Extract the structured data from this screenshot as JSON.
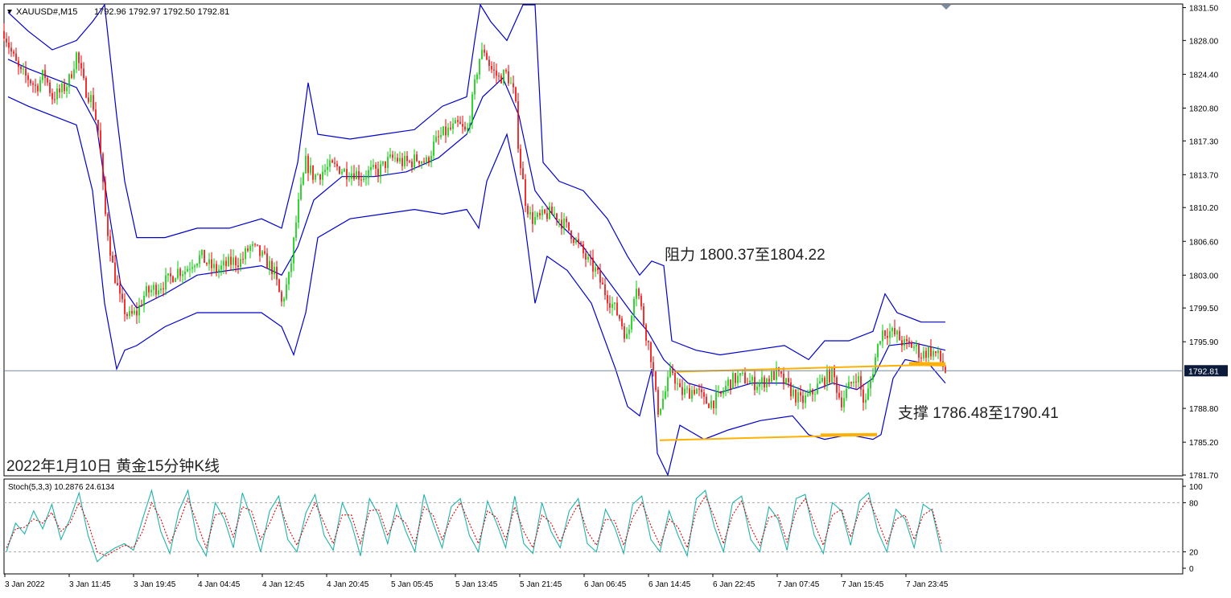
{
  "header": {
    "symbol": "XAUUSD#,M15",
    "ohlc": "1792.96 1792.97 1792.50 1792.81"
  },
  "annotations": {
    "resistance": "阻力 1800.37至1804.22",
    "support": "支撑 1786.48至1790.41",
    "caption": "2022年1月10日 黄金15分钟K线"
  },
  "colors": {
    "background": "#ffffff",
    "bull_candle": "#00cc00",
    "bear_candle": "#ee0000",
    "bollinger": "#0000cc",
    "level_line": "#ffb000",
    "stoch_main": "#20b2aa",
    "stoch_signal": "#dd0000",
    "grid_dash": "#aaaaaa",
    "price_marker_bg": "#0b1a3a"
  },
  "chart_data": [
    {
      "type": "candlestick",
      "y_ticks": [
        "1831.50",
        "1828.00",
        "1824.40",
        "1820.80",
        "1817.30",
        "1813.70",
        "1810.20",
        "1806.60",
        "1803.00",
        "1799.50",
        "1795.90",
        "1788.80",
        "1785.20",
        "1781.70"
      ],
      "ylim": [
        1781.7,
        1831.8
      ],
      "current_price": "1792.81",
      "x_ticks": [
        "3 Jan 2022",
        "3 Jan 11:45",
        "3 Jan 19:45",
        "4 Jan 04:45",
        "4 Jan 12:45",
        "4 Jan 20:45",
        "5 Jan 05:45",
        "5 Jan 13:45",
        "5 Jan 21:45",
        "6 Jan 06:45",
        "6 Jan 14:45",
        "6 Jan 22:45",
        "7 Jan 07:45",
        "7 Jan 15:45",
        "7 Jan 23:45"
      ],
      "close_path": [
        [
          0,
          1829.0
        ],
        [
          10,
          1826.5
        ],
        [
          20,
          1824.5
        ],
        [
          30,
          1824.0
        ],
        [
          40,
          1823.0
        ],
        [
          50,
          1824.5
        ],
        [
          60,
          1822.0
        ],
        [
          70,
          1822.5
        ],
        [
          80,
          1823.5
        ],
        [
          90,
          1826.5
        ],
        [
          100,
          1823.0
        ],
        [
          110,
          1821.5
        ],
        [
          118,
          1818.0
        ],
        [
          125,
          1810.0
        ],
        [
          135,
          1804.0
        ],
        [
          145,
          1800.0
        ],
        [
          155,
          1798.5
        ],
        [
          165,
          1799.0
        ],
        [
          175,
          1801.0
        ],
        [
          185,
          1801.5
        ],
        [
          195,
          1802.0
        ],
        [
          205,
          1802.5
        ],
        [
          215,
          1803.5
        ],
        [
          225,
          1803.5
        ],
        [
          235,
          1804.5
        ],
        [
          245,
          1805.0
        ],
        [
          255,
          1804.0
        ],
        [
          265,
          1803.5
        ],
        [
          275,
          1804.0
        ],
        [
          285,
          1804.5
        ],
        [
          295,
          1804.5
        ],
        [
          305,
          1806.0
        ],
        [
          315,
          1805.5
        ],
        [
          325,
          1804.5
        ],
        [
          335,
          1803.5
        ],
        [
          345,
          1800.0
        ],
        [
          355,
          1803.0
        ],
        [
          365,
          1810.0
        ],
        [
          375,
          1815.0
        ],
        [
          385,
          1813.5
        ],
        [
          395,
          1814.0
        ],
        [
          405,
          1814.5
        ],
        [
          415,
          1814.5
        ],
        [
          425,
          1814.0
        ],
        [
          435,
          1814.0
        ],
        [
          445,
          1813.5
        ],
        [
          455,
          1814.0
        ],
        [
          465,
          1814.0
        ],
        [
          475,
          1815.0
        ],
        [
          485,
          1815.5
        ],
        [
          495,
          1815.0
        ],
        [
          505,
          1815.0
        ],
        [
          515,
          1815.5
        ],
        [
          525,
          1815.0
        ],
        [
          535,
          1817.0
        ],
        [
          545,
          1818.0
        ],
        [
          555,
          1818.5
        ],
        [
          565,
          1819.0
        ],
        [
          575,
          1818.0
        ],
        [
          583,
          1822.0
        ],
        [
          590,
          1826.0
        ],
        [
          597,
          1827.0
        ],
        [
          605,
          1825.0
        ],
        [
          615,
          1824.0
        ],
        [
          625,
          1824.5
        ],
        [
          635,
          1822.0
        ],
        [
          640,
          1816.0
        ],
        [
          648,
          1811.0
        ],
        [
          655,
          1809.0
        ],
        [
          665,
          1809.0
        ],
        [
          675,
          1809.5
        ],
        [
          685,
          1809.5
        ],
        [
          695,
          1808.5
        ],
        [
          705,
          1807.5
        ],
        [
          715,
          1806.0
        ],
        [
          725,
          1804.5
        ],
        [
          735,
          1803.5
        ],
        [
          745,
          1801.5
        ],
        [
          755,
          1800.0
        ],
        [
          765,
          1798.5
        ],
        [
          775,
          1796.0
        ],
        [
          785,
          1802.5
        ],
        [
          795,
          1798.0
        ],
        [
          805,
          1794.0
        ],
        [
          812,
          1788.5
        ],
        [
          820,
          1790.0
        ],
        [
          830,
          1793.0
        ],
        [
          840,
          1790.5
        ],
        [
          850,
          1790.5
        ],
        [
          860,
          1791.0
        ],
        [
          870,
          1789.5
        ],
        [
          880,
          1789.5
        ],
        [
          890,
          1790.0
        ],
        [
          900,
          1791.5
        ],
        [
          910,
          1792.0
        ],
        [
          920,
          1792.0
        ],
        [
          930,
          1791.5
        ],
        [
          940,
          1791.5
        ],
        [
          950,
          1792.0
        ],
        [
          960,
          1792.5
        ],
        [
          970,
          1791.5
        ],
        [
          980,
          1790.5
        ],
        [
          990,
          1789.5
        ],
        [
          1000,
          1790.0
        ],
        [
          1010,
          1791.0
        ],
        [
          1020,
          1792.0
        ],
        [
          1030,
          1792.5
        ],
        [
          1040,
          1789.5
        ],
        [
          1050,
          1791.0
        ],
        [
          1060,
          1792.5
        ],
        [
          1070,
          1789.0
        ],
        [
          1080,
          1793.0
        ],
        [
          1090,
          1797.0
        ],
        [
          1100,
          1797.0
        ],
        [
          1110,
          1796.5
        ],
        [
          1120,
          1795.5
        ],
        [
          1130,
          1795.5
        ],
        [
          1140,
          1794.5
        ],
        [
          1150,
          1795.0
        ],
        [
          1160,
          1794.5
        ],
        [
          1170,
          1792.8
        ]
      ],
      "bb_mid": [
        [
          5,
          1826
        ],
        [
          30,
          1825
        ],
        [
          60,
          1824
        ],
        [
          90,
          1823
        ],
        [
          115,
          1819
        ],
        [
          130,
          1810
        ],
        [
          145,
          1802
        ],
        [
          165,
          1799.5
        ],
        [
          200,
          1801
        ],
        [
          240,
          1803
        ],
        [
          280,
          1803.5
        ],
        [
          320,
          1804
        ],
        [
          345,
          1803
        ],
        [
          365,
          1806
        ],
        [
          385,
          1811
        ],
        [
          420,
          1813.5
        ],
        [
          460,
          1813.5
        ],
        [
          500,
          1814
        ],
        [
          540,
          1815.5
        ],
        [
          575,
          1818
        ],
        [
          595,
          1822
        ],
        [
          620,
          1824
        ],
        [
          640,
          1820
        ],
        [
          660,
          1812
        ],
        [
          690,
          1808.5
        ],
        [
          720,
          1806
        ],
        [
          750,
          1802.5
        ],
        [
          780,
          1799
        ],
        [
          800,
          1797
        ],
        [
          820,
          1794
        ],
        [
          850,
          1791.5
        ],
        [
          890,
          1790.5
        ],
        [
          930,
          1791.5
        ],
        [
          970,
          1791.5
        ],
        [
          1000,
          1790.5
        ],
        [
          1030,
          1791.5
        ],
        [
          1060,
          1790.8
        ],
        [
          1080,
          1792
        ],
        [
          1100,
          1795.5
        ],
        [
          1130,
          1795.8
        ],
        [
          1170,
          1795
        ]
      ],
      "bb_upper": [
        [
          5,
          1831
        ],
        [
          30,
          1829
        ],
        [
          60,
          1827
        ],
        [
          90,
          1828
        ],
        [
          110,
          1830
        ],
        [
          125,
          1831.8
        ],
        [
          140,
          1820
        ],
        [
          150,
          1813
        ],
        [
          165,
          1807
        ],
        [
          200,
          1807
        ],
        [
          240,
          1808
        ],
        [
          280,
          1808
        ],
        [
          320,
          1809
        ],
        [
          345,
          1808
        ],
        [
          365,
          1815
        ],
        [
          378,
          1823.5
        ],
        [
          390,
          1818
        ],
        [
          430,
          1817.5
        ],
        [
          470,
          1818
        ],
        [
          510,
          1818.5
        ],
        [
          545,
          1821
        ],
        [
          575,
          1822
        ],
        [
          585,
          1828
        ],
        [
          592,
          1831.8
        ],
        [
          605,
          1830
        ],
        [
          625,
          1828
        ],
        [
          645,
          1831.8
        ],
        [
          660,
          1831.8
        ],
        [
          670,
          1815
        ],
        [
          690,
          1813
        ],
        [
          720,
          1812
        ],
        [
          750,
          1809
        ],
        [
          775,
          1805
        ],
        [
          790,
          1803
        ],
        [
          805,
          1804.5
        ],
        [
          820,
          1804
        ],
        [
          830,
          1796
        ],
        [
          860,
          1795
        ],
        [
          890,
          1794.5
        ],
        [
          930,
          1795
        ],
        [
          970,
          1795.5
        ],
        [
          1000,
          1794
        ],
        [
          1020,
          1796
        ],
        [
          1050,
          1796
        ],
        [
          1080,
          1797
        ],
        [
          1095,
          1801
        ],
        [
          1110,
          1799
        ],
        [
          1140,
          1798
        ],
        [
          1170,
          1798
        ]
      ],
      "bb_lower": [
        [
          5,
          1822
        ],
        [
          30,
          1821
        ],
        [
          60,
          1820
        ],
        [
          90,
          1819
        ],
        [
          110,
          1812
        ],
        [
          125,
          1800
        ],
        [
          140,
          1793
        ],
        [
          150,
          1795
        ],
        [
          165,
          1795.5
        ],
        [
          200,
          1797.5
        ],
        [
          240,
          1799
        ],
        [
          280,
          1799
        ],
        [
          320,
          1799
        ],
        [
          345,
          1797.5
        ],
        [
          360,
          1794.5
        ],
        [
          375,
          1799
        ],
        [
          390,
          1807
        ],
        [
          430,
          1809
        ],
        [
          470,
          1809.5
        ],
        [
          510,
          1810
        ],
        [
          545,
          1809.5
        ],
        [
          575,
          1810
        ],
        [
          590,
          1808
        ],
        [
          600,
          1813
        ],
        [
          625,
          1818
        ],
        [
          645,
          1810
        ],
        [
          660,
          1800
        ],
        [
          675,
          1805
        ],
        [
          700,
          1803.5
        ],
        [
          730,
          1800
        ],
        [
          760,
          1793
        ],
        [
          775,
          1789
        ],
        [
          790,
          1788
        ],
        [
          805,
          1793
        ],
        [
          812,
          1784
        ],
        [
          825,
          1781.7
        ],
        [
          840,
          1787
        ],
        [
          870,
          1785.5
        ],
        [
          900,
          1786.5
        ],
        [
          940,
          1787.5
        ],
        [
          980,
          1788
        ],
        [
          1000,
          1786
        ],
        [
          1020,
          1785.5
        ],
        [
          1050,
          1786
        ],
        [
          1080,
          1785.5
        ],
        [
          1090,
          1786
        ],
        [
          1105,
          1792
        ],
        [
          1120,
          1794
        ],
        [
          1150,
          1793.5
        ],
        [
          1170,
          1791.5
        ]
      ],
      "resistance_level": {
        "from": [
          835,
          1792.7
        ],
        "to": [
          1170,
          1793.5
        ]
      },
      "support_level": {
        "from": [
          815,
          1785.4
        ],
        "to": [
          1085,
          1786.0
        ]
      }
    },
    {
      "type": "line",
      "name": "Stoch(5,3,3) 10.2876 24.6134",
      "y_ticks": [
        "100",
        "80",
        "20",
        "0"
      ],
      "ylim": [
        0,
        100
      ],
      "levels": [
        20,
        80
      ],
      "series": [
        {
          "values": [
            20,
            55,
            42,
            70,
            48,
            78,
            35,
            60,
            92,
            40,
            8,
            18,
            25,
            30,
            22,
            60,
            95,
            45,
            18,
            70,
            95,
            35,
            15,
            80,
            60,
            25,
            92,
            60,
            20,
            70,
            88,
            35,
            20,
            68,
            90,
            40,
            22,
            80,
            55,
            15,
            85,
            65,
            30,
            78,
            45,
            20,
            90,
            55,
            25,
            75,
            85,
            40,
            20,
            82,
            55,
            25,
            88,
            30,
            18,
            80,
            45,
            25,
            70,
            85,
            30,
            20,
            72,
            50,
            18,
            78,
            88,
            35,
            20,
            70,
            40,
            15,
            85,
            95,
            50,
            20,
            80,
            88,
            35,
            20,
            75,
            60,
            22,
            85,
            90,
            40,
            18,
            80,
            70,
            28,
            82,
            92,
            45,
            20,
            72,
            60,
            25,
            78,
            70,
            20
          ]
        },
        {
          "values": [
            25,
            48,
            50,
            60,
            55,
            68,
            45,
            55,
            80,
            55,
            20,
            15,
            22,
            28,
            25,
            45,
            80,
            60,
            30,
            55,
            85,
            55,
            25,
            65,
            68,
            38,
            75,
            70,
            35,
            55,
            80,
            50,
            28,
            55,
            80,
            55,
            30,
            65,
            65,
            30,
            70,
            72,
            40,
            65,
            55,
            30,
            75,
            65,
            35,
            62,
            80,
            55,
            30,
            70,
            62,
            35,
            75,
            45,
            25,
            65,
            55,
            32,
            58,
            78,
            45,
            28,
            60,
            58,
            28,
            62,
            80,
            52,
            28,
            60,
            50,
            25,
            70,
            88,
            62,
            30,
            65,
            82,
            50,
            28,
            62,
            65,
            32,
            70,
            85,
            55,
            28,
            65,
            72,
            38,
            70,
            85,
            58,
            30,
            60,
            65,
            35,
            65,
            72,
            30
          ]
        }
      ]
    }
  ]
}
